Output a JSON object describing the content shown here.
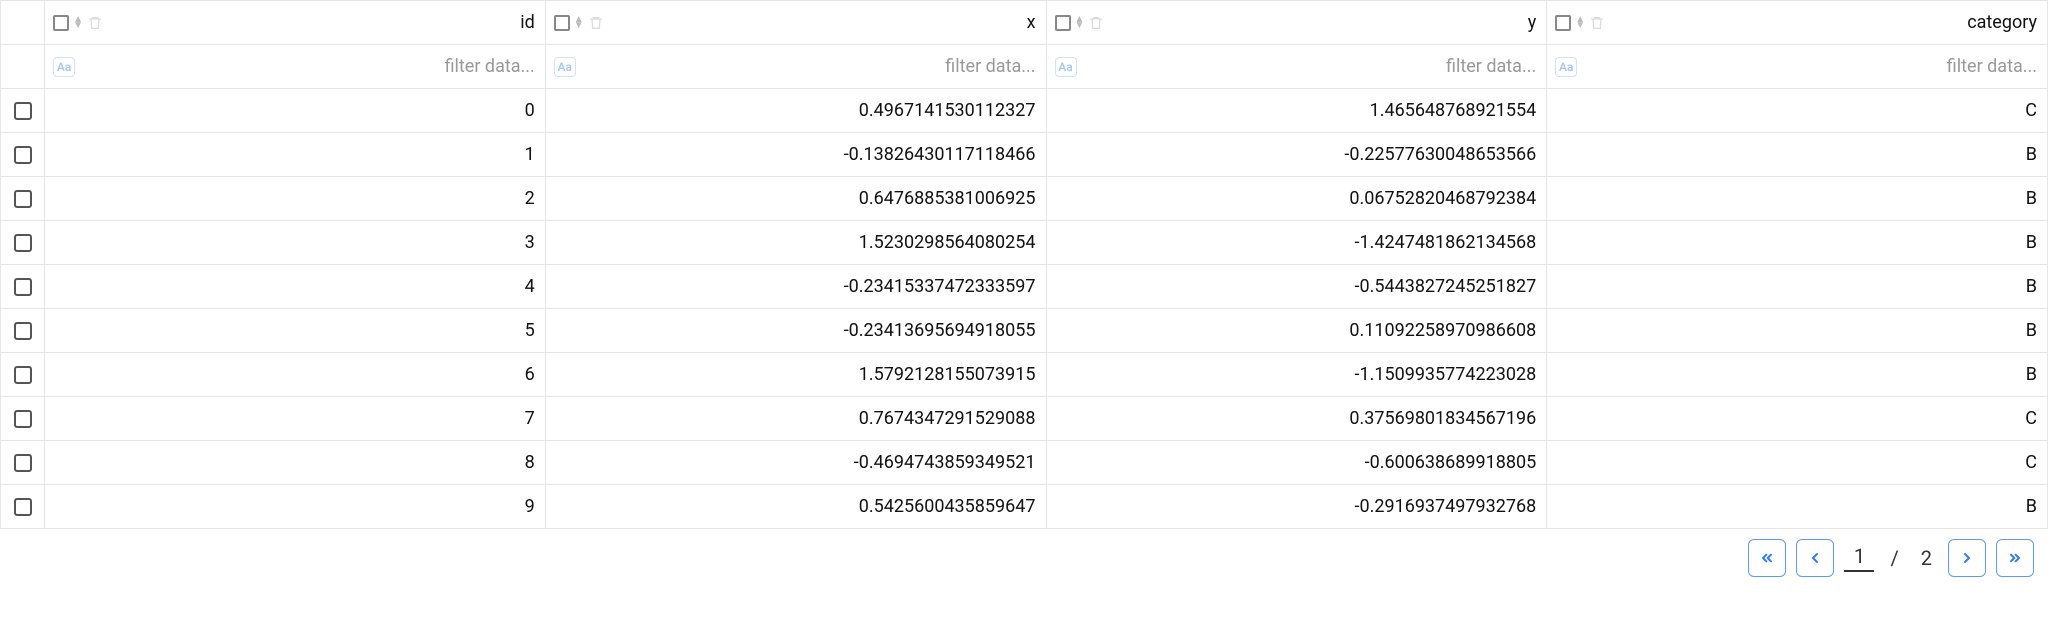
{
  "columns": {
    "id": "id",
    "x": "x",
    "y": "y",
    "category": "category"
  },
  "filter": {
    "placeholder": "filter data...",
    "aa": "Aa"
  },
  "rows": [
    {
      "id": "0",
      "x": "0.4967141530112327",
      "y": "1.465648768921554",
      "category": "C"
    },
    {
      "id": "1",
      "x": "-0.13826430117118466",
      "y": "-0.22577630048653566",
      "category": "B"
    },
    {
      "id": "2",
      "x": "0.6476885381006925",
      "y": "0.06752820468792384",
      "category": "B"
    },
    {
      "id": "3",
      "x": "1.5230298564080254",
      "y": "-1.4247481862134568",
      "category": "B"
    },
    {
      "id": "4",
      "x": "-0.23415337472333597",
      "y": "-0.5443827245251827",
      "category": "B"
    },
    {
      "id": "5",
      "x": "-0.23413695694918055",
      "y": "0.11092258970986608",
      "category": "B"
    },
    {
      "id": "6",
      "x": "1.5792128155073915",
      "y": "-1.1509935774223028",
      "category": "B"
    },
    {
      "id": "7",
      "x": "0.7674347291529088",
      "y": "0.37569801834567196",
      "category": "C"
    },
    {
      "id": "8",
      "x": "-0.4694743859349521",
      "y": "-0.600638689918805",
      "category": "C"
    },
    {
      "id": "9",
      "x": "0.5425600435859647",
      "y": "-0.2916937497932768",
      "category": "B"
    }
  ],
  "pagination": {
    "current": "1",
    "separator": "/",
    "total": "2"
  }
}
